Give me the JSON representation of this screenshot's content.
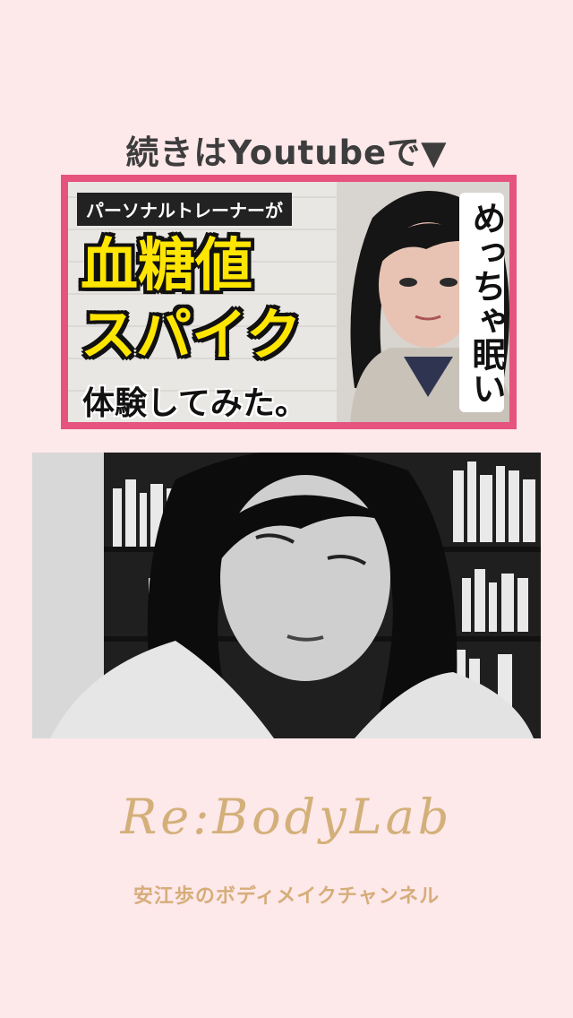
{
  "headline": "続きはYoutubeで▼",
  "thumbnail": {
    "tag": "パーソナルトレーナーが",
    "big_line1": "血糖値",
    "big_line2": "スパイク",
    "sub_line": "体験してみた。",
    "vertical_caption": "めっちゃ眠い"
  },
  "brand": {
    "logo": "Re:BodyLab",
    "channel": "安江歩のボディメイクチャンネル"
  }
}
